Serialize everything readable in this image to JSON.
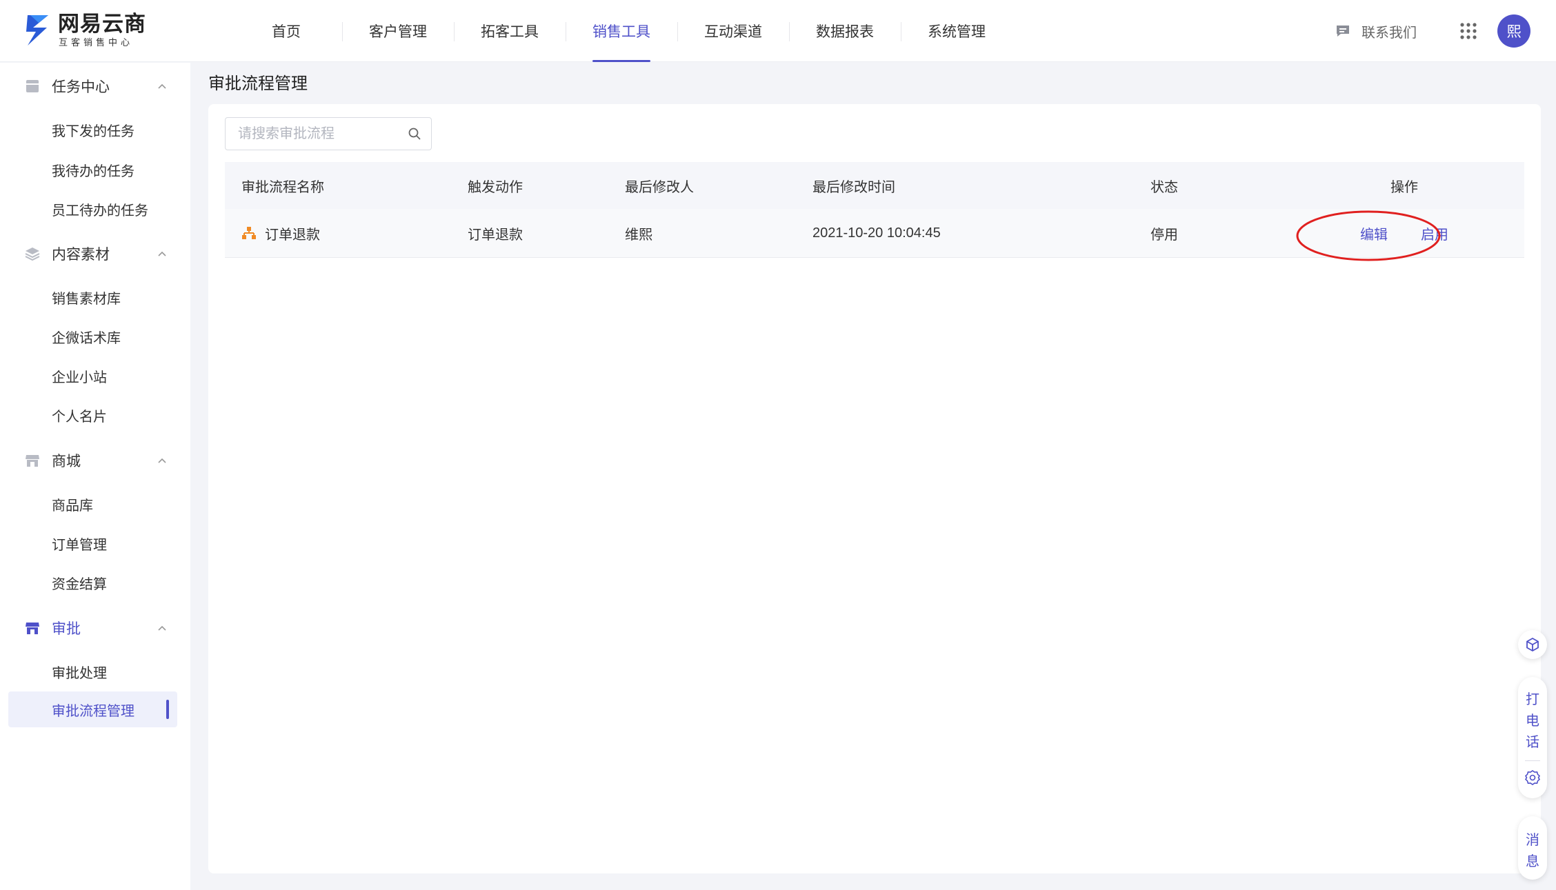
{
  "brand": {
    "name": "网易云商",
    "subtitle": "互客销售中心",
    "accent_color": "#4f51c9",
    "logo_colors": [
      "#3a8ef6",
      "#2a5bd7"
    ]
  },
  "nav": {
    "items": [
      {
        "label": "首页",
        "active": false
      },
      {
        "label": "客户管理",
        "active": false
      },
      {
        "label": "拓客工具",
        "active": false
      },
      {
        "label": "销售工具",
        "active": true
      },
      {
        "label": "互动渠道",
        "active": false
      },
      {
        "label": "数据报表",
        "active": false
      },
      {
        "label": "系统管理",
        "active": false
      }
    ],
    "contact_label": "联系我们",
    "contact_icon": "message-icon",
    "apps_icon": "apps-grid-icon",
    "avatar_text": "熙"
  },
  "sidebar": {
    "groups": [
      {
        "label": "任务中心",
        "icon": "task-icon",
        "expanded": true,
        "items": [
          "我下发的任务",
          "我待办的任务",
          "员工待办的任务"
        ]
      },
      {
        "label": "内容素材",
        "icon": "layers-icon",
        "expanded": true,
        "items": [
          "销售素材库",
          "企微话术库",
          "企业小站",
          "个人名片"
        ]
      },
      {
        "label": "商城",
        "icon": "store-icon",
        "expanded": true,
        "items": [
          "商品库",
          "订单管理",
          "资金结算"
        ]
      },
      {
        "label": "审批",
        "icon": "approval-icon",
        "expanded": true,
        "active": true,
        "items": [
          "审批处理",
          "审批流程管理"
        ]
      }
    ],
    "active_item": "审批流程管理"
  },
  "page": {
    "title": "审批流程管理",
    "search": {
      "placeholder": "请搜索审批流程",
      "value": ""
    }
  },
  "table": {
    "columns": [
      "审批流程名称",
      "触发动作",
      "最后修改人",
      "最后修改时间",
      "状态",
      "操作"
    ],
    "rows": [
      {
        "name": "订单退款",
        "trigger": "订单退款",
        "modifier": "维熙",
        "modified_time": "2021-10-20 10:04:45",
        "status": "停用",
        "actions": [
          "编辑",
          "启用"
        ]
      }
    ],
    "highlight_color": "#e0201f"
  },
  "float_tools": {
    "cube_icon": "cube-icon",
    "call_label": "打电话",
    "settings_icon": "gear-icon",
    "message_label": "消息"
  }
}
